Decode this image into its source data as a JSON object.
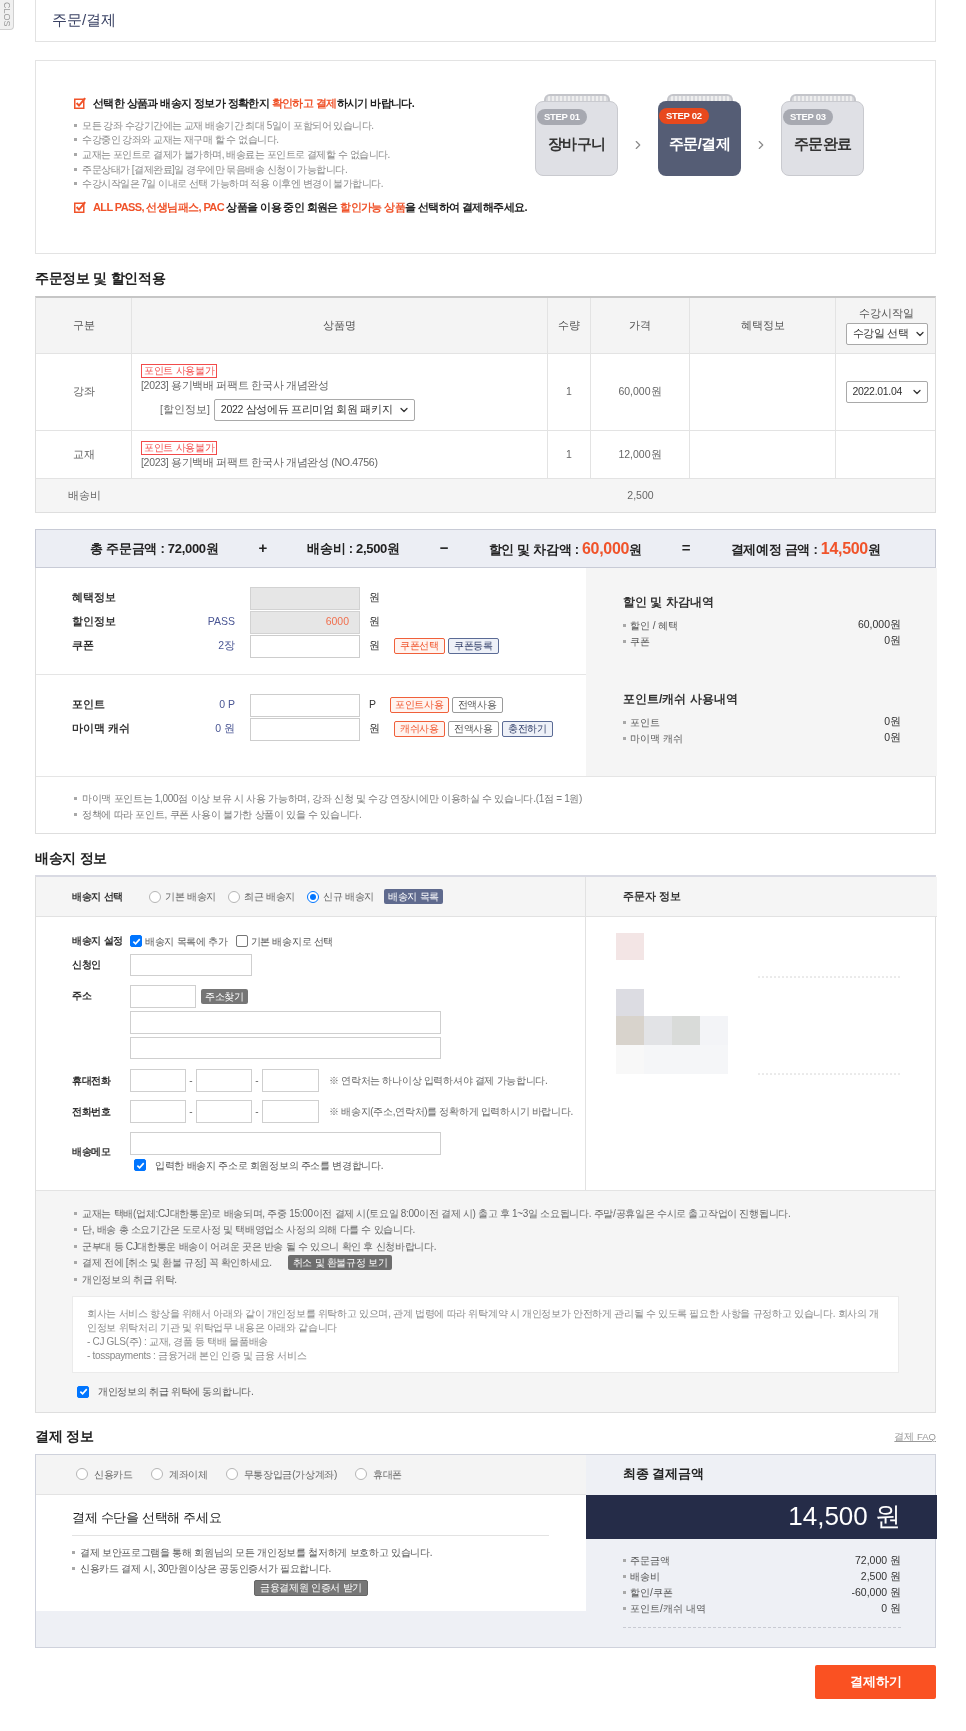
{
  "side_tab": "CLOS",
  "page_title": "주문/결제",
  "notice": {
    "headline": [
      {
        "text": "선택한 상품과 배송지 정보가 정확한지 ",
        "highlight": false
      },
      {
        "text": "확인하고 결제",
        "highlight": true
      },
      {
        "text": "하시기 바랍니다.",
        "highlight": false
      }
    ],
    "bullets": [
      "모든 강좌 수강기간에는 교재 배송기간 최대 5일이 포함되어 있습니다.",
      "수강중인 강좌와 교재는 재구매 할 수 없습니다.",
      "교재는 포인트로 결제가 불가하며, 배송료는 포인트로 결제할 수 없습니다.",
      "주문상태가 [결제완료]일 경우에만 묶음배송 신청이 가능합니다.",
      "수강시작일은 7일 이내로 선택 가능하며 적용 이후엔 변경이 불가합니다."
    ],
    "footnote": [
      {
        "text": "ALL PASS, 선생님패스, PAC",
        "highlight": true
      },
      {
        "text": " 상품을 이용 중인 회원은 ",
        "highlight": false
      },
      {
        "text": "할인가능 상품",
        "highlight": true
      },
      {
        "text": "을 선택하여 결제해주세요.",
        "highlight": false
      }
    ],
    "steps": [
      {
        "number": "STEP 01",
        "label": "장바구니",
        "selected": false
      },
      {
        "number": "STEP 02",
        "label": "주문/결제",
        "selected": true
      },
      {
        "number": "STEP 03",
        "label": "주문완료",
        "selected": false
      }
    ]
  },
  "order": {
    "title": "주문정보 및 할인적용",
    "columns": [
      "구분",
      "상품명",
      "수량",
      "가격",
      "혜택정보",
      "수강시작일"
    ],
    "start_date_select": "수강일 선택",
    "rows": [
      {
        "category": "강좌",
        "badge": "포인트 사용불가",
        "name": "[2023] 용기백배 퍼팩트 한국사 개념완성",
        "discount_label": "[할인정보]",
        "discount_select": "2022 삼성에듀 프리미엄 회원 패키지",
        "quantity": "1",
        "price": "60,000원",
        "start_date": "2022.01.04"
      },
      {
        "category": "교재",
        "badge": "포인트 사용불가",
        "name": "[2023] 용기백배 퍼팩트 한국사 개념완성 (NO.4756)",
        "quantity": "1",
        "price": "12,000원"
      }
    ],
    "shipping": {
      "label": "배송비",
      "value": "2,500"
    }
  },
  "summary": {
    "items": [
      {
        "label": "총 주문금액 : ",
        "amount": "72,000",
        "unit": "원",
        "highlight": false
      },
      {
        "label": "배송비 : ",
        "amount": "2,500",
        "unit": "원",
        "highlight": false
      },
      {
        "label": "할인 및 차감액 : ",
        "amount": "60,000",
        "unit": "원",
        "highlight": true
      },
      {
        "label": "결제예정 금액 : ",
        "amount": "14,500",
        "unit": "원",
        "highlight": true
      }
    ],
    "operators": [
      "+",
      "−",
      "="
    ]
  },
  "benefits": {
    "rows": [
      {
        "label": "혜택정보",
        "unit": "원",
        "disabled": true
      },
      {
        "label": "할인정보",
        "info": "PASS",
        "value": "6000",
        "unit": "원",
        "disabled": true
      },
      {
        "label": "쿠폰",
        "info": "2장",
        "unit": "원",
        "disabled": false,
        "buttons": [
          {
            "label": "쿠폰선택",
            "kind": "accent"
          },
          {
            "label": "쿠폰등록",
            "kind": "primary"
          }
        ]
      }
    ],
    "summary": {
      "title": "할인 및 차감내역",
      "items": [
        {
          "label": "할인 / 혜택",
          "value": "60,000원"
        },
        {
          "label": "쿠폰",
          "value": "0원"
        }
      ]
    }
  },
  "points": {
    "rows": [
      {
        "label": "포인트",
        "info": "0 P",
        "unit": "P",
        "disabled": false,
        "buttons": [
          {
            "label": "포인트사용",
            "kind": "accent"
          },
          {
            "label": "전액사용",
            "kind": "plain"
          }
        ]
      },
      {
        "label": "마이맥 캐쉬",
        "info": "0 원",
        "unit": "원",
        "disabled": false,
        "buttons": [
          {
            "label": "캐쉬사용",
            "kind": "accent"
          },
          {
            "label": "전액사용",
            "kind": "plain"
          },
          {
            "label": "충전하기",
            "kind": "primary"
          }
        ]
      }
    ],
    "summary": {
      "title": "포인트/캐쉬 사용내역",
      "items": [
        {
          "label": "포인트",
          "value": "0원"
        },
        {
          "label": "마이맥 캐쉬",
          "value": "0원"
        }
      ]
    }
  },
  "benefit_notes": [
    "마이맥 포인트는 1,000점 이상 보유 시 사용 가능하며, 강좌 신청 및 수강 연장시에만 이용하실 수 있습니다.(1점 = 1원)",
    "정책에 따라 포인트, 쿠폰 사용이 불가한 상품이 있을 수 있습니다."
  ],
  "delivery": {
    "title": "배송지 정보",
    "select_label": "배송지 선택",
    "options": [
      {
        "label": "기본 배송지",
        "selected": false
      },
      {
        "label": "최근 배송지",
        "selected": false
      },
      {
        "label": "신규 배송지",
        "selected": true
      }
    ],
    "list_button": "배송지 목록",
    "orderer_title": "주문자 정보",
    "settings_label": "배송지 설정",
    "settings": [
      {
        "label": "배송지 목록에 추가",
        "checked": true
      },
      {
        "label": "기본 배송지로 선택",
        "checked": false
      }
    ],
    "name_label": "신청인",
    "address_label": "주소",
    "address_button": "주소찾기",
    "mobile": {
      "label": "휴대전화",
      "separators": [
        "-",
        "-"
      ],
      "note": "※ 연락처는 하나이상 입력하셔야 결제 가능합니다."
    },
    "phone": {
      "label": "전화번호",
      "separators": [
        "-",
        "-"
      ],
      "note": "※ 배송지(주소,연락처)를 정확하게 입력하시기 바랍니다."
    },
    "memo_label": "배송메모",
    "update_address": {
      "label": "입력한 배송지 주소로 회원정보의 주소를 변경합니다.",
      "checked": true
    },
    "notes": [
      {
        "text": "교재는 택배(업체:CJ대한통운)로 배송되며, 주중 15:00이전 결제 시(토요일 8:00이전 결제 시) 출고 후 1~3일 소요됩니다. 주말/공휴일은 수시로 출고작업이 진행됩니다."
      },
      {
        "text": "단, 배송 총 소요기간은 도로사정 및 택배영업소 사정의 의해 다를 수 있습니다."
      },
      {
        "text": "군부대 등 CJ대한통운 배송이 어려운 곳은 반송 될 수 있으니 확인 후 신청바랍니다."
      },
      {
        "text": "결제 전에 [취소 및 환불 규정] 꼭 확인하세요.",
        "button": "취소 및 환불규정 보기"
      },
      {
        "text": "개인정보의 취급 위탁."
      }
    ],
    "privacy": [
      "회사는 서비스 향상을 위해서 아래와 같이 개인정보를 위탁하고 있으며, 관계 법령에 따라 위탁계약 시 개인정보가 안전하게 관리될 수 있도록 필요한 사항을 규정하고 있습니다. 회사의 개인정보 위탁처리 기관 및 위탁업무 내용은 아래와 같습니다",
      "- CJ GLS(주) : 교재, 경품 등 택배 물품배송",
      "- tosspayments : 금융거래 본인 인증 및 금융 서비스"
    ],
    "privacy_agree": {
      "label": "개인정보의 취급 위탁에 동의합니다.",
      "checked": true
    }
  },
  "payment": {
    "title": "결제 정보",
    "faq_link": "결제 FAQ",
    "methods": [
      {
        "label": "신용카드",
        "selected": false
      },
      {
        "label": "계좌이체",
        "selected": false
      },
      {
        "label": "무통장입금(가상계좌)",
        "selected": false
      },
      {
        "label": "휴대폰",
        "selected": false
      }
    ],
    "prompt": "결제 수단을 선택해 주세요",
    "notes": [
      "결제 보안프로그램을 통해 회원님의 모든 개인정보를 철저하게 보호하고 있습니다.",
      "신용카드 결제 시, 30만원이상은 공동인증서가 필요합니다."
    ],
    "cert_button": "금융결제원 인증서 받기",
    "final_title": "최종 결제금액",
    "final_amount": "14,500 원",
    "breakdown": [
      {
        "label": "주문금액",
        "value": "72,000 원"
      },
      {
        "label": "배송비",
        "value": "2,500 원"
      },
      {
        "label": "할인/쿠폰",
        "value": "-60,000 원"
      },
      {
        "label": "포인트/캐쉬 내역",
        "value": "0 원"
      }
    ]
  },
  "pay_button": "결제하기"
}
